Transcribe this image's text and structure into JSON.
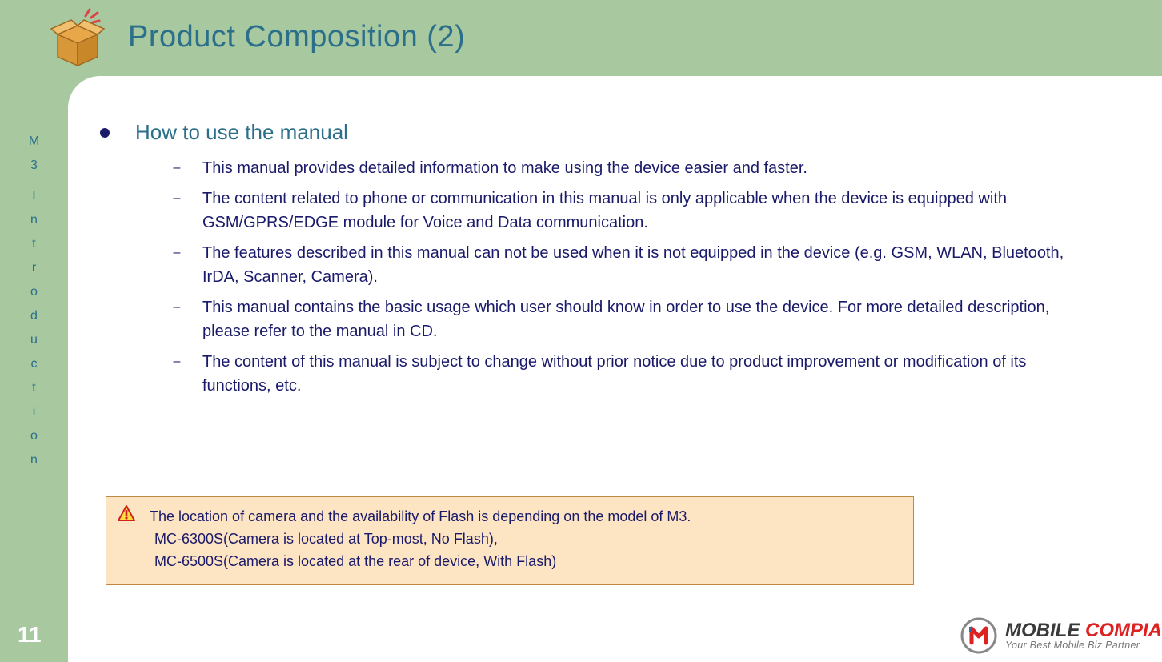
{
  "title": "Product Composition (2)",
  "side_label": "M3 Introduction",
  "page_number": "11",
  "heading": "How to use the manual",
  "items": [
    "This manual provides detailed information to make using the device easier and faster.",
    "The content related to phone or communication in this manual is only applicable when the device is equipped with GSM/GPRS/EDGE module for Voice and Data communication.",
    "The features described in this manual can not be used when it is not equipped in the device (e.g. GSM, WLAN, Bluetooth, IrDA, Scanner, Camera).",
    "This manual contains the basic usage which user should know in order to use the device. For more detailed description, please refer to the manual in CD.",
    "The content of this manual is subject to change without prior notice due to product improvement or modification of its functions, etc."
  ],
  "note": {
    "line1": "The location of camera and the availability of Flash is depending on the model of M3.",
    "line2": "MC-6300S(Camera is located at Top-most, No Flash),",
    "line3": "MC-6500S(Camera is located at the rear of device, With Flash)"
  },
  "logo": {
    "word1": "MOBILE",
    "word2": "COMPIA",
    "tagline": "Your Best Mobile Biz Partner"
  }
}
